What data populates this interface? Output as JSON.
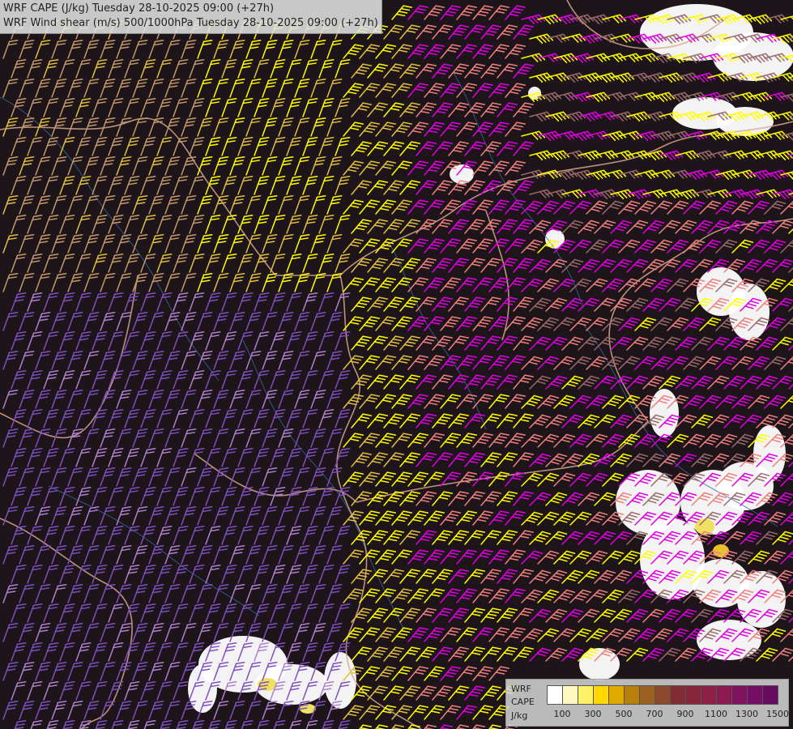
{
  "title": {
    "line1": "WRF CAPE (J/kg) Tuesday 28-10-2025 09:00 (+27h)",
    "line2": "WRF Wind shear (m/s) 500/1000hPa Tuesday 28-10-2025 09:00 (+27h)"
  },
  "legend": {
    "label_model": "WRF",
    "label_field": "CAPE",
    "label_unit": "J/kg",
    "ticks": [
      "100",
      "300",
      "500",
      "700",
      "900",
      "1100",
      "1300",
      "1500"
    ],
    "colors": [
      "#ffffff",
      "#fff7c0",
      "#fff06a",
      "#ffd800",
      "#e0a800",
      "#b8800a",
      "#9c6020",
      "#8c4a2a",
      "#802e33",
      "#86243a",
      "#8c2045",
      "#8a1a50",
      "#7e1460",
      "#740e66",
      "#680a60"
    ]
  },
  "palette": {
    "background": "#1d1519",
    "borders": "#d8a890",
    "rivers": "#3a6aa0",
    "white_fill": "#ffffff",
    "barb_colors": [
      "#c59a6a",
      "#e0c040",
      "#ffff00",
      "#f08080",
      "#e000e0",
      "#8050c0",
      "#9a6a6a",
      "#b080d0"
    ]
  },
  "map": {
    "field": "wind shear barbs over CAPE",
    "valid": "Tuesday 28-10-2025 09:00 (+27h)"
  }
}
